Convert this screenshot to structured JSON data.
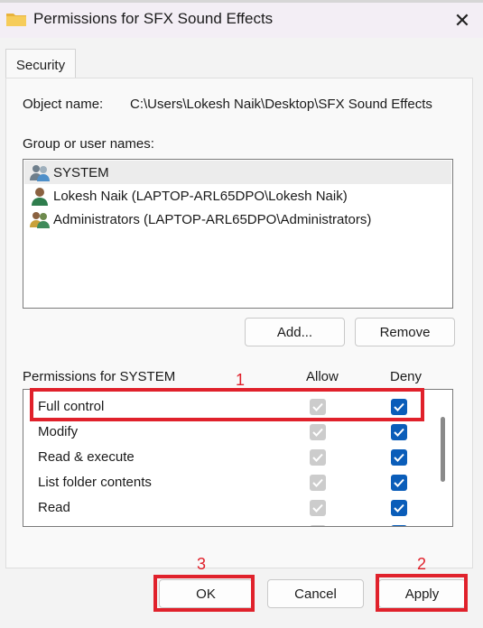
{
  "window": {
    "title": "Permissions for SFX Sound Effects",
    "close_glyph": "✕"
  },
  "tabs": [
    {
      "label": "Security",
      "active": true
    }
  ],
  "object": {
    "label": "Object name:",
    "value": "C:\\Users\\Lokesh Naik\\Desktop\\SFX Sound Effects"
  },
  "groups": {
    "label": "Group or user names:",
    "items": [
      {
        "name": "SYSTEM",
        "icon": "users-group-icon",
        "selected": true
      },
      {
        "name": "Lokesh Naik (LAPTOP-ARL65DPO\\Lokesh Naik)",
        "icon": "user-icon",
        "selected": false
      },
      {
        "name": "Administrators (LAPTOP-ARL65DPO\\Administrators)",
        "icon": "users-group-icon",
        "selected": false
      }
    ],
    "add_label": "Add...",
    "remove_label": "Remove"
  },
  "permissions": {
    "header": "Permissions for SYSTEM",
    "allow_header": "Allow",
    "deny_header": "Deny",
    "items": [
      {
        "name": "Full control",
        "allow": true,
        "allow_enabled": false,
        "deny": true
      },
      {
        "name": "Modify",
        "allow": true,
        "allow_enabled": false,
        "deny": true
      },
      {
        "name": "Read & execute",
        "allow": true,
        "allow_enabled": false,
        "deny": true
      },
      {
        "name": "List folder contents",
        "allow": true,
        "allow_enabled": false,
        "deny": true
      },
      {
        "name": "Read",
        "allow": true,
        "allow_enabled": false,
        "deny": true
      }
    ]
  },
  "footer": {
    "ok_label": "OK",
    "cancel_label": "Cancel",
    "apply_label": "Apply"
  },
  "annotations": [
    {
      "number": "1",
      "target": "Full control row"
    },
    {
      "number": "2",
      "target": "Apply button"
    },
    {
      "number": "3",
      "target": "OK button"
    }
  ],
  "colors": {
    "accent": "#0a5db9",
    "annotation_red": "#e0212b",
    "disabled_check": "#cccccc"
  }
}
